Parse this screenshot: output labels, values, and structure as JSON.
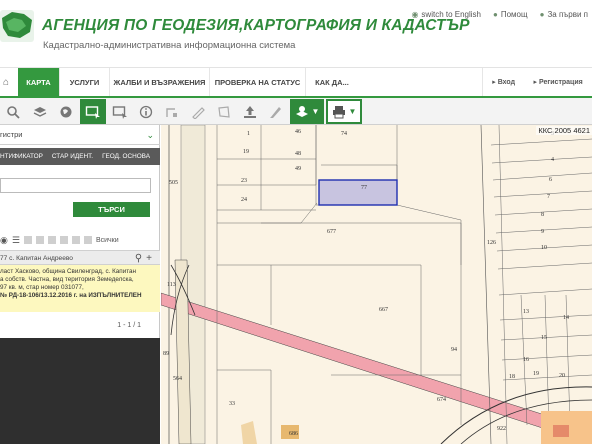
{
  "header": {
    "title": "АГЕНЦИЯ ПО ГЕОДЕЗИЯ,КАРТОГРАФИЯ И КАДАСТЪР",
    "subtitle": "Кадастрално-административна информационна система",
    "links": [
      {
        "icon": "globe-icon",
        "label": "switch to English"
      },
      {
        "icon": "help-icon",
        "label": "Помощ"
      },
      {
        "icon": "user-icon",
        "label": "За първи п"
      }
    ]
  },
  "nav": {
    "items": [
      "КАРТА",
      "УСЛУГИ",
      "ЖАЛБИ И ВЪЗРАЖЕНИЯ",
      "ПРОВЕРКА НА СТАТУС",
      "КАК ДА..."
    ],
    "active": "КАРТА",
    "login": "Вход",
    "register": "Регистрация"
  },
  "toolbar": {
    "tools": [
      "zoom-icon",
      "layers-icon",
      "globe-icon",
      "select-rectangle-icon",
      "select-area-icon",
      "info-icon",
      "measure-distance-icon",
      "ruler-icon",
      "measure-area-icon",
      "upload-icon",
      "draw-icon",
      "layers-dropdown-icon",
      "print-icon"
    ]
  },
  "panel": {
    "registry_select": "гистри",
    "search_tabs": [
      "НТИФИКАТОР",
      "СТАР ИДЕНТ.",
      "ГЕОД. ОСНОВА"
    ],
    "search_value": "",
    "search_button": "ТЪРСИ",
    "all_label": "Всички",
    "result_title": "77 с. Капитан Андреево",
    "result_lines": [
      "ласт Хасково, община Свиленград, с. Капитан",
      "а собств. Частна, вид територия Земеделска,",
      "97 кв. м, стар номер 031077,",
      "№ РД-18-106/13.12.2016 г. на ИЗПЪЛНИТЕЛЕН"
    ],
    "pager": "1 - 1 / 1"
  },
  "map": {
    "coordinate_system": "ККС 2005 4621",
    "selected_parcel": "77",
    "parcel_labels": [
      "1",
      "46",
      "74",
      "3",
      "19",
      "48",
      "4",
      "49",
      "505",
      "23",
      "77",
      "6",
      "24",
      "7",
      "677",
      "8",
      "126",
      "9",
      "10",
      "113",
      "667",
      "13",
      "14",
      "15",
      "16",
      "94",
      "89",
      "18",
      "19",
      "20",
      "564",
      "674",
      "33",
      "686",
      "922"
    ]
  },
  "colors": {
    "brand_green": "#2f8a3b",
    "selection": "#1f2fb0",
    "road": "#f1a3ad",
    "map_background": "#fbf3e4"
  }
}
